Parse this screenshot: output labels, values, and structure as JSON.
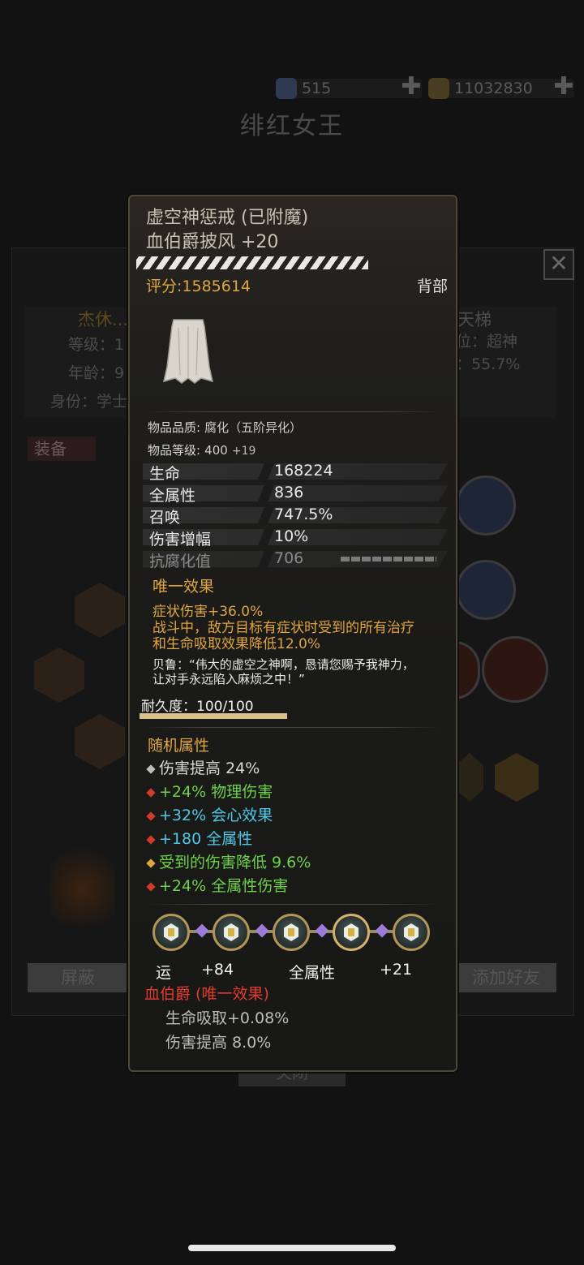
{
  "currency": {
    "gems": "515",
    "gold": "11032830",
    "add_symbol": "✚"
  },
  "background": {
    "page_title": "绯红女王",
    "close_symbol": "✕",
    "player_name": "杰休...",
    "level_label": "等级：1",
    "age_label": "年龄：9",
    "identity_label": "身份：学士",
    "ladder_label": "天梯",
    "rank_label": "位：超神",
    "rate_label": "：55.7%",
    "equip_tab": "装备",
    "block_button": "屏蔽",
    "add_friend_button": "添加好友",
    "close_button": "关闭"
  },
  "tooltip": {
    "name_line1": "虚空神惩戒 (已附魔)",
    "name_line2": "血伯爵披风 +20",
    "score": "评分:1585614",
    "slot": "背部",
    "quality_label": "物品品质:",
    "quality_value": "腐化（五阶异化）",
    "level_label": "物品等级:",
    "level_value": "400",
    "level_bonus": "+19",
    "stats": [
      {
        "name": "生命",
        "value": "168224"
      },
      {
        "name": "全属性",
        "value": "836"
      },
      {
        "name": "召唤",
        "value": "747.5%"
      },
      {
        "name": "伤害增幅",
        "value": "10%"
      },
      {
        "name": "抗腐化值",
        "value": "706"
      }
    ],
    "unique_header": "唯一效果",
    "unique_lines": [
      "症状伤害+36.0%",
      "战斗中，敌方目标有症状时受到的所有治疗",
      "和生命吸取效果降低12.0%"
    ],
    "quote_lines": [
      "贝鲁：“伟大的虚空之神啊，恳请您赐予我神力，",
      "让对手永远陷入麻烦之中！”"
    ],
    "durability": "耐久度：100/100",
    "durability_fraction": 1.0,
    "random_header": "随机属性",
    "random_attrs": [
      {
        "text": "伤害提高 24%",
        "color": "#d8d8d8",
        "dot": "#bfbfbf"
      },
      {
        "text": "+24% 物理伤害",
        "color": "#6fd24a",
        "dot": "#d23a2e"
      },
      {
        "text": "+32% 会心效果",
        "color": "#4fc9e8",
        "dot": "#d23a2e"
      },
      {
        "text": "+180 全属性",
        "color": "#4fc9e8",
        "dot": "#d23a2e"
      },
      {
        "text": "受到的伤害降低 9.6%",
        "color": "#6fd24a",
        "dot": "#e0a640"
      },
      {
        "text": "+24% 全属性伤害",
        "color": "#6fd24a",
        "dot": "#d23a2e"
      }
    ],
    "gem_labels": [
      "运",
      "+84",
      "全属性",
      "+21"
    ],
    "set_header": "血伯爵 (唯一效果)",
    "set_lines": [
      "生命吸取+0.08%",
      "伤害提高 8.0%"
    ]
  },
  "colors": {
    "gold_text": "#e0a640",
    "set_red": "#e23a2e",
    "frame": "#4d473b"
  }
}
